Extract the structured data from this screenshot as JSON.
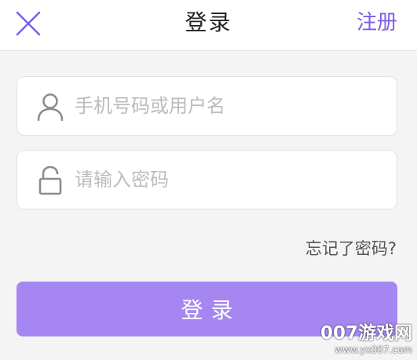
{
  "header": {
    "title": "登录",
    "close_icon": "close-icon",
    "register_label": "注册"
  },
  "form": {
    "username": {
      "icon": "user-icon",
      "placeholder": "手机号码或用户名",
      "value": ""
    },
    "password": {
      "icon": "lock-icon",
      "placeholder": "请输入密码",
      "value": ""
    },
    "forgot_label": "忘记了密码?",
    "login_label": "登录"
  },
  "watermark": {
    "brand": "007游戏网",
    "url": "www.yx007.com"
  },
  "colors": {
    "accent": "#7b5ee6",
    "button": "#a687f2",
    "background": "#f4f4f4",
    "icon_gray": "#8c8c8c"
  }
}
